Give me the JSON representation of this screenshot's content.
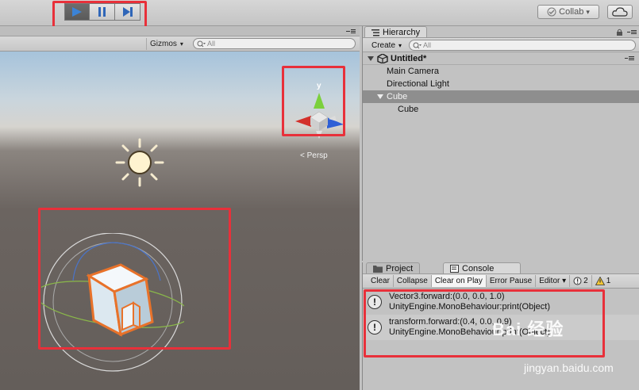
{
  "toolbar": {
    "collab_label": "Collab",
    "collab_caret": "▾",
    "play_icon": "play-icon",
    "pause_icon": "pause-icon",
    "step_icon": "step-icon",
    "active_color": "#3b83d6"
  },
  "scene": {
    "gizmos_label": "Gizmos",
    "gizmos_caret": "▾",
    "search_placeholder": "All",
    "gizmo_y_label": "y",
    "persp_label": "< Persp"
  },
  "hierarchy": {
    "tab_label": "Hierarchy",
    "create_label": "Create",
    "create_caret": "▾",
    "search_placeholder": "All",
    "scene_name": "Untitled*",
    "items": [
      {
        "label": "Main Camera"
      },
      {
        "label": "Directional Light"
      },
      {
        "label": "Cube"
      },
      {
        "label": "Cube"
      }
    ]
  },
  "console": {
    "tabs": [
      {
        "label": "Project"
      },
      {
        "label": "Console"
      }
    ],
    "buttons": [
      {
        "label": "Clear"
      },
      {
        "label": "Collapse"
      },
      {
        "label": "Clear on Play"
      },
      {
        "label": "Error Pause"
      },
      {
        "label": "Editor ▾"
      }
    ],
    "log_count": "2",
    "warn_count": "1",
    "entries": [
      {
        "line1": "Vector3.forward:(0.0, 0.0, 1.0)",
        "line2": "UnityEngine.MonoBehaviour:print(Object)"
      },
      {
        "line1": "transform.forward:(0.4, 0.0, 0.9)",
        "line2": "UnityEngine.MonoBehaviour:print(Object)"
      }
    ]
  },
  "watermark": {
    "brand": "Bai 经验",
    "url": "jingyan.baidu.com"
  }
}
